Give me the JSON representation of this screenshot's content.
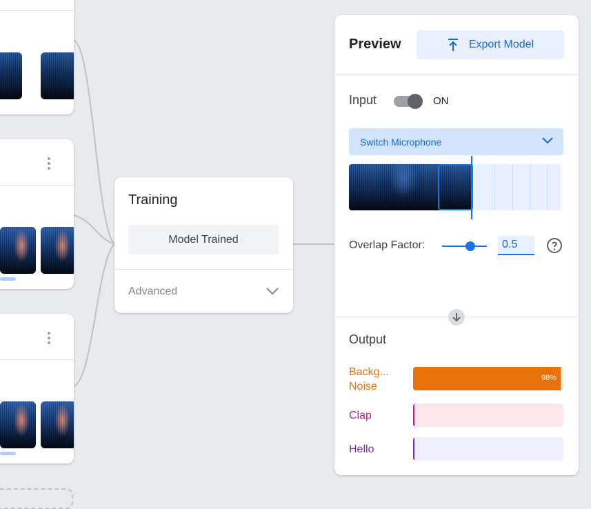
{
  "training": {
    "title": "Training",
    "status_button": "Model Trained",
    "advanced_label": "Advanced"
  },
  "preview": {
    "title": "Preview",
    "export_label": "Export Model",
    "input_label": "Input",
    "input_toggle_state": "ON",
    "microphone_button": "Switch Microphone",
    "overlap_label": "Overlap Factor:",
    "overlap_value": "0.5",
    "overlap_fraction": 0.5,
    "output_title": "Output",
    "outputs": [
      {
        "label_line1": "Backg...",
        "label_line2": "Noise",
        "percent": "98%",
        "fraction": 0.98,
        "color": "#e8710a",
        "track": "#fde7d3"
      },
      {
        "label_line1": "Clap",
        "label_line2": "",
        "percent": "",
        "fraction": 0.0,
        "color": "#d01884",
        "track": "#fde7ea"
      },
      {
        "label_line1": "Hello",
        "label_line2": "",
        "percent": "",
        "fraction": 0.0,
        "color": "#7627bb",
        "track": "#f0effd"
      }
    ]
  },
  "colors": {
    "accent": "#1a73e8",
    "background": "#e8eaed"
  },
  "icons": {
    "export": "upload-arrow-icon",
    "mic_dropdown": "chevron-down-icon",
    "advanced": "chevron-down-icon",
    "help": "help-circle-icon",
    "flow": "arrow-down-icon",
    "class_menu": "more-vert-icon"
  }
}
